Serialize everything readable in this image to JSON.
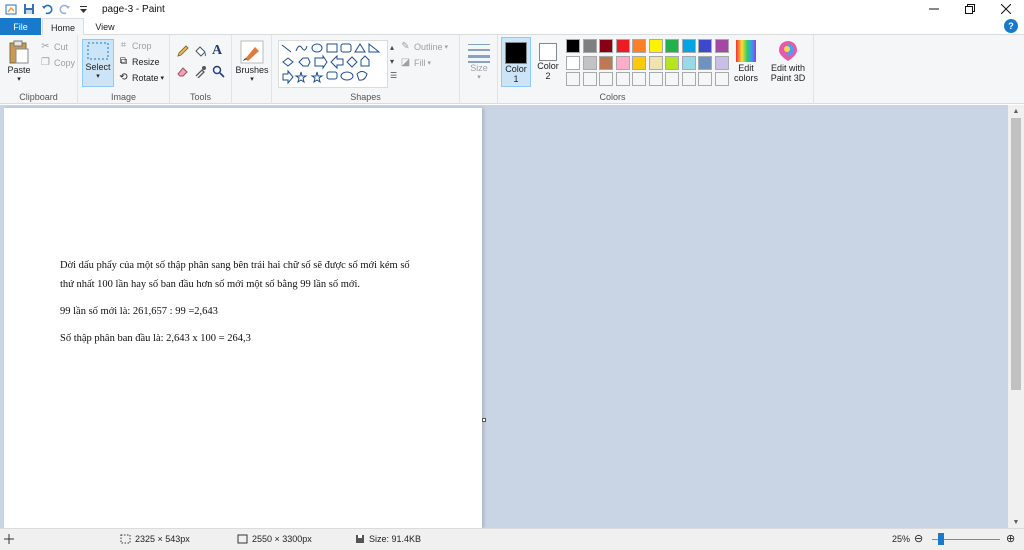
{
  "window": {
    "title": "page-3 - Paint",
    "minimize_icon": "minimize-icon",
    "restore_icon": "restore-icon",
    "close_icon": "close-icon"
  },
  "tabs": {
    "file": "File",
    "home": "Home",
    "view": "View"
  },
  "ribbon": {
    "clipboard": {
      "label": "Clipboard",
      "paste": "Paste",
      "cut": "Cut",
      "copy": "Copy"
    },
    "image": {
      "label": "Image",
      "select": "Select",
      "crop": "Crop",
      "resize": "Resize",
      "rotate": "Rotate"
    },
    "tools": {
      "label": "Tools"
    },
    "brushes": {
      "label": "Brushes"
    },
    "shapes": {
      "label": "Shapes",
      "outline": "Outline",
      "fill": "Fill"
    },
    "size": {
      "label": "Size"
    },
    "colors": {
      "label": "Colors",
      "color1": "Color",
      "color1_num": "1",
      "color2": "Color",
      "color2_num": "2",
      "edit_colors_1": "Edit",
      "edit_colors_2": "colors",
      "paint3d_1": "Edit with",
      "paint3d_2": "Paint 3D",
      "palette_row1": [
        "#000000",
        "#7f7f7f",
        "#880015",
        "#ed1c24",
        "#ff7f27",
        "#fff200",
        "#22b14c",
        "#00a2e8",
        "#3f48cc",
        "#a349a4"
      ],
      "palette_row2": [
        "#ffffff",
        "#c3c3c3",
        "#b97a57",
        "#ffaec9",
        "#ffc90e",
        "#efe4b0",
        "#b5e61d",
        "#99d9ea",
        "#7092be",
        "#c8bfe7"
      ],
      "accent": "#1979ca"
    }
  },
  "document": {
    "para1_line1": "Dời dấu phẩy của một số thập phân sang bên trái hai chữ số sẽ được số mới kém số",
    "para1_line2": "thứ nhất 100 lần hay số ban đầu hơn số mới một số bằng 99 lần số mới.",
    "para2": "99 lần số mới là: 261,657 : 99 =2,643",
    "para3": "Số thập phân ban đầu là: 2,643 x 100 = 264,3"
  },
  "status": {
    "selection_size": "2325 × 543px",
    "image_size": "2550 × 3300px",
    "file_size": "Size: 91.4KB",
    "zoom": "25%"
  }
}
